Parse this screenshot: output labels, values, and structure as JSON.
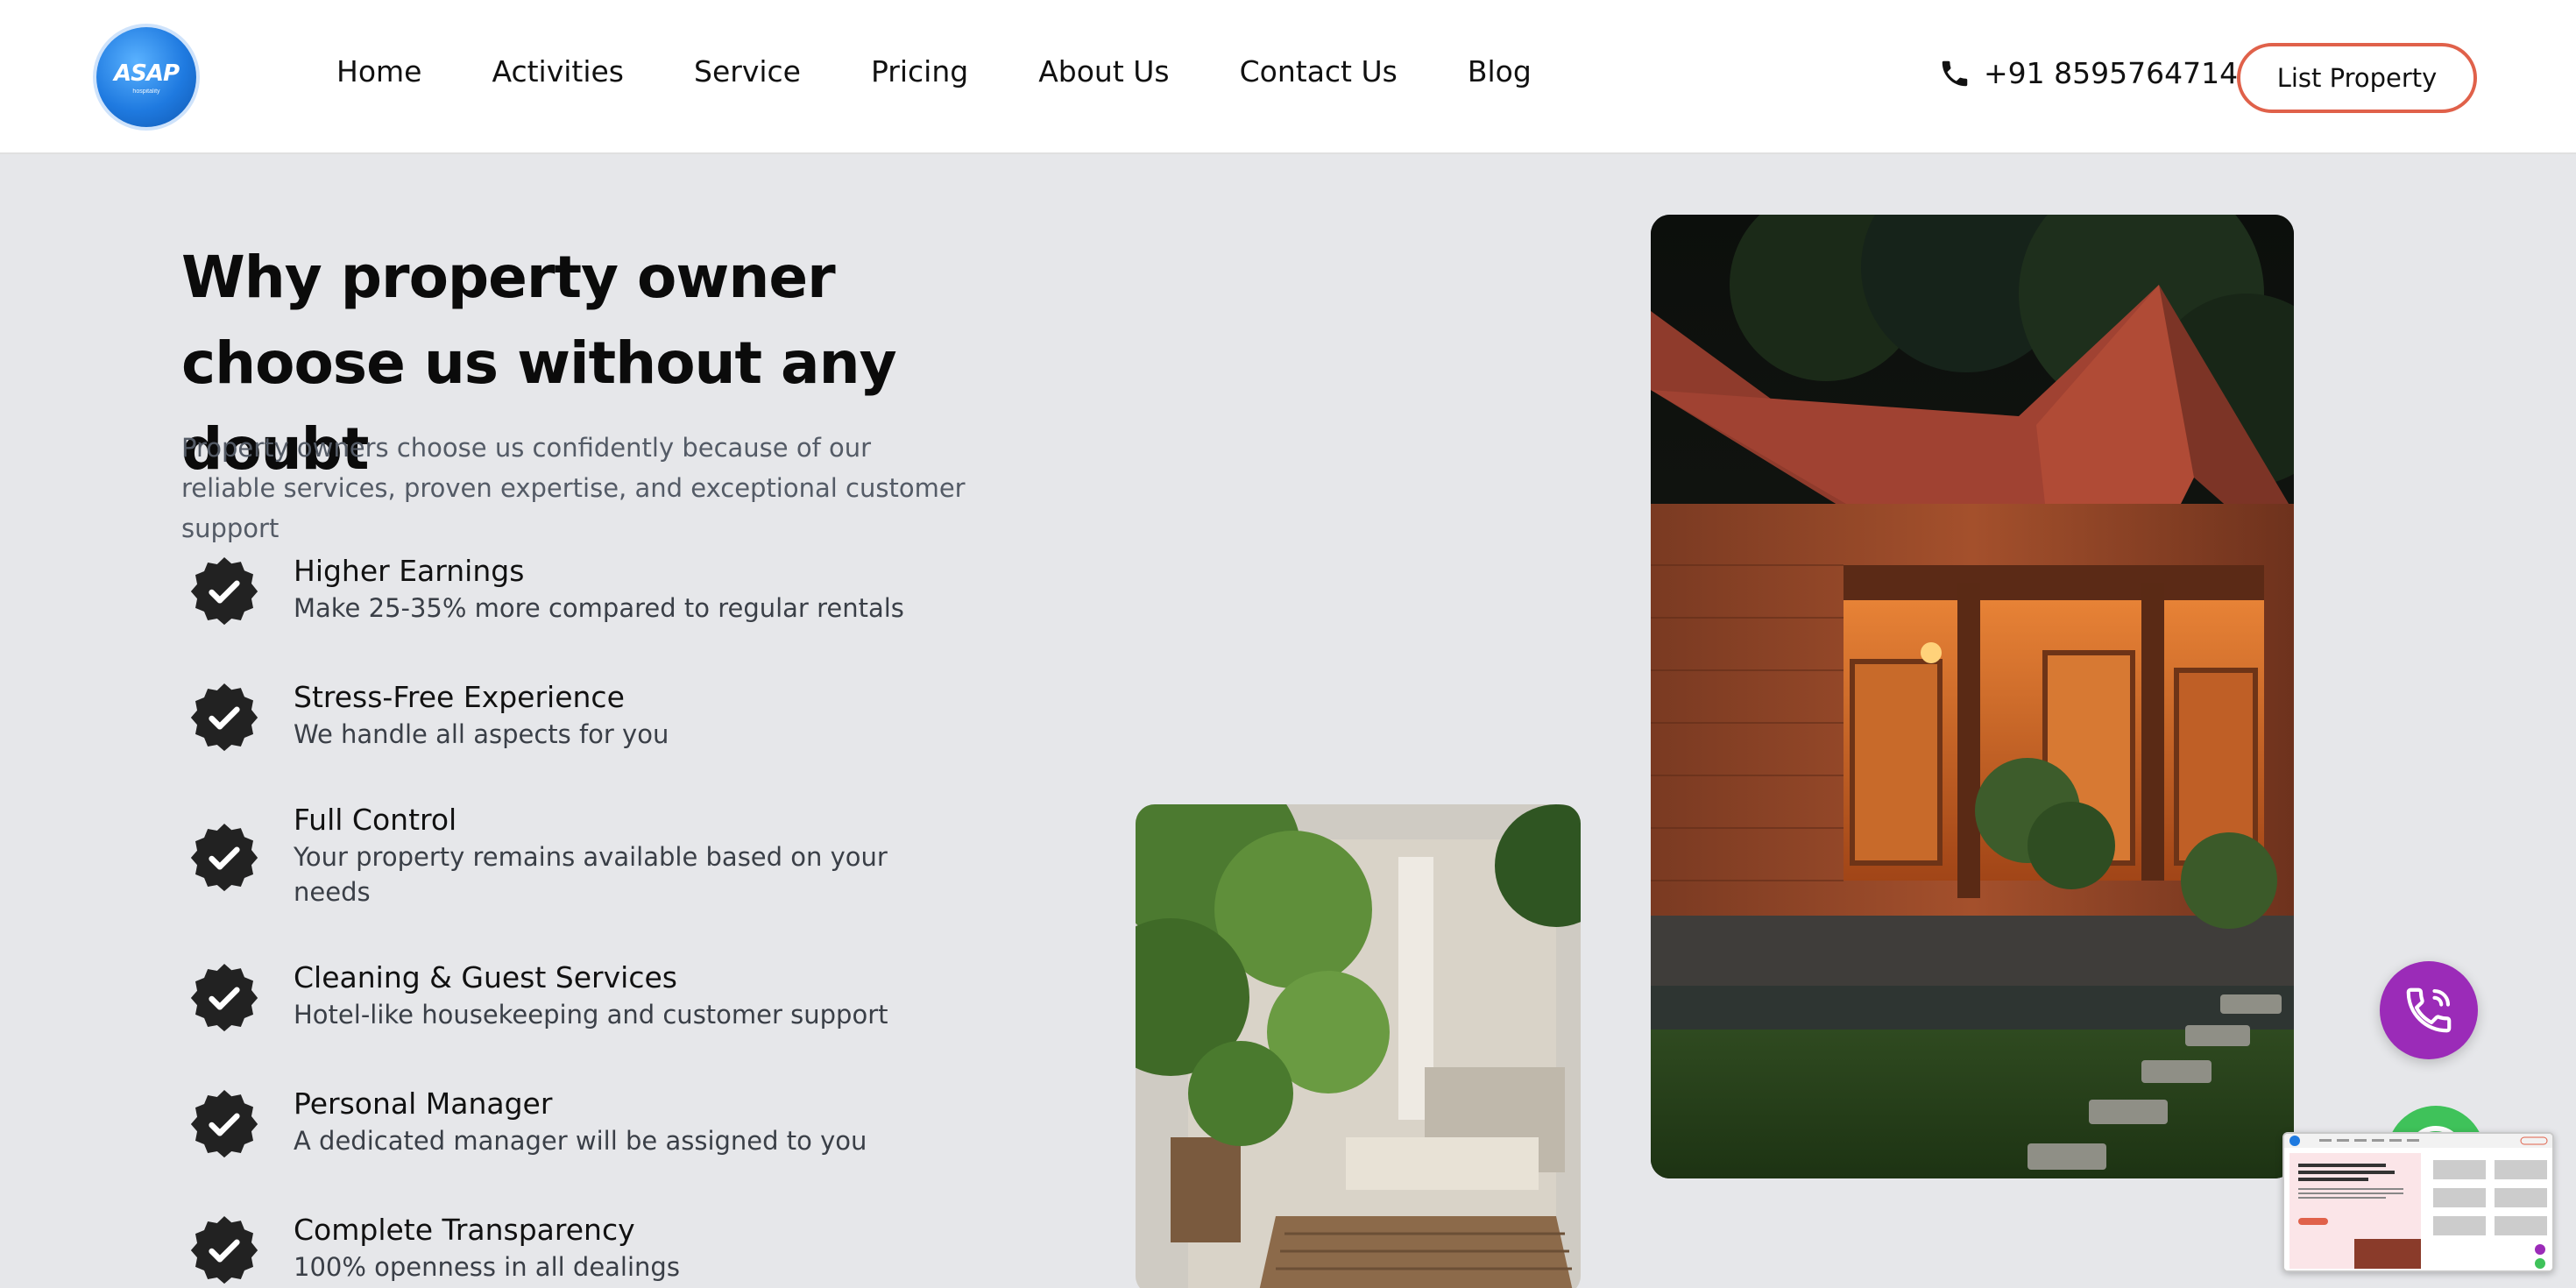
{
  "header": {
    "logo_text": "ASAP",
    "logo_sub": "hospitality",
    "nav": [
      {
        "label": "Home"
      },
      {
        "label": "Activities"
      },
      {
        "label": "Service"
      },
      {
        "label": "Pricing"
      },
      {
        "label": "About Us"
      },
      {
        "label": "Contact Us"
      },
      {
        "label": "Blog"
      }
    ],
    "phone": "+91 8595764714",
    "cta_label": "List Property"
  },
  "hero": {
    "title": "Why property owner choose us without any doubt",
    "subtitle": "Property owners choose us confidently because of our reliable services, proven expertise, and exceptional customer support"
  },
  "features": [
    {
      "title": "Higher Earnings",
      "desc": "Make 25-35% more compared to regular rentals"
    },
    {
      "title": "Stress-Free Experience",
      "desc": "We handle all aspects for you"
    },
    {
      "title": "Full Control",
      "desc": "Your property remains available based on your needs"
    },
    {
      "title": "Cleaning & Guest Services",
      "desc": "Hotel-like housekeeping and customer support"
    },
    {
      "title": "Personal Manager",
      "desc": "A dedicated manager will be assigned to you"
    },
    {
      "title": "Complete Transparency",
      "desc": "100% openness in all dealings"
    }
  ],
  "colors": {
    "accent_border": "#e0614a",
    "call_fab": "#9b2bb8",
    "whatsapp_fab": "#3fc25a",
    "page_bg": "#e6e7ea"
  },
  "icons": [
    "phone-icon",
    "verified-badge-icon",
    "phone-call-icon",
    "whatsapp-icon"
  ]
}
